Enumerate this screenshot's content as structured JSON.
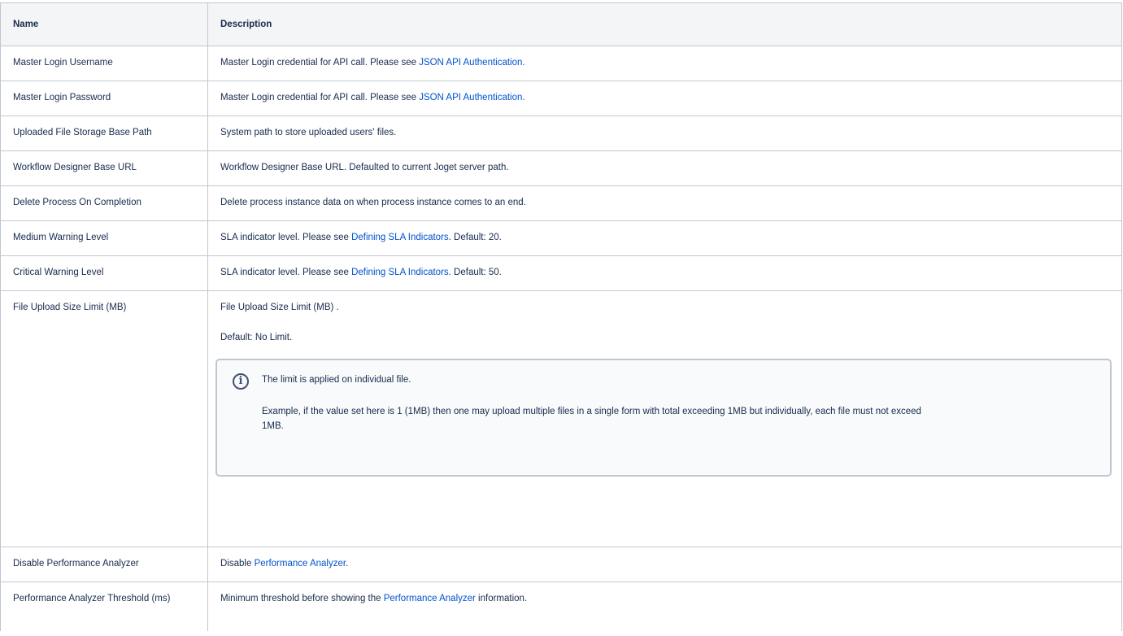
{
  "headers": {
    "name": "Name",
    "description": "Description"
  },
  "rows": [
    {
      "name": "Master Login Username",
      "desc_before": "Master Login credential for API call. Please see ",
      "link": " JSON API Authentication.",
      "desc_after": ""
    },
    {
      "name": "Master Login Password",
      "desc_before": "Master Login credential for API call. Please see ",
      "link": "JSON API Authentication.",
      "desc_after": ""
    },
    {
      "name": "Uploaded File Storage Base Path",
      "desc_before": "System path to store uploaded users' files.",
      "link": "",
      "desc_after": ""
    },
    {
      "name": "Workflow Designer Base URL",
      "desc_before": "Workflow Designer Base URL. Defaulted to current Joget server path.",
      "link": "",
      "desc_after": ""
    },
    {
      "name": "Delete Process On Completion",
      "desc_before": "Delete process instance data on when process instance comes to an end.",
      "link": "",
      "desc_after": ""
    },
    {
      "name": "Medium Warning Level",
      "desc_before": "SLA indicator level. Please see ",
      "link": "Defining SLA Indicators",
      "desc_after": ". Default: 20."
    },
    {
      "name": "Critical Warning Level",
      "desc_before": "SLA indicator level. Please see ",
      "link": "Defining SLA Indicators",
      "desc_after": ". Default: 50."
    }
  ],
  "upload_row": {
    "name": "File Upload Size Limit (MB)",
    "desc": "File Upload Size Limit (MB) .",
    "default": "Default: No Limit.",
    "info": {
      "icon": "info-icon",
      "line1": "The limit is applied on individual file.",
      "line2a": "Example, if the value set here is 1 (1MB) then one may upload multiple files in a single form with total exceeding 1MB but individually, each file must not exceed",
      "line2b": "1MB."
    }
  },
  "rows2": [
    {
      "name": "Disable Performance Analyzer",
      "desc_before": "Disable ",
      "link": "Performance Analyzer",
      "desc_after": "."
    },
    {
      "name": "Performance Analyzer Threshold (ms)",
      "desc_before": "Minimum threshold before showing the ",
      "link": "Performance Analyzer",
      "desc_after": " information."
    }
  ],
  "colors": {
    "link": "#0052cc",
    "header_bg": "#f4f5f7",
    "border": "#c1c7d0",
    "text": "#172b4d"
  }
}
